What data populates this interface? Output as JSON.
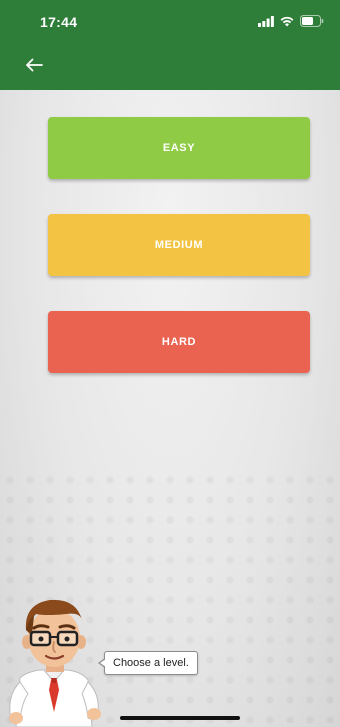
{
  "status_bar": {
    "time": "17:44",
    "icons": [
      "signal-icon",
      "wifi-icon",
      "battery-icon"
    ]
  },
  "app_bar": {
    "back_icon": "back-arrow-icon",
    "color": "#2e7d39"
  },
  "levels": [
    {
      "label": "EASY",
      "color": "#8fcb45"
    },
    {
      "label": "MEDIUM",
      "color": "#f3c444"
    },
    {
      "label": "HARD",
      "color": "#ea6250"
    }
  ],
  "mascot": {
    "speech": "Choose a level."
  }
}
